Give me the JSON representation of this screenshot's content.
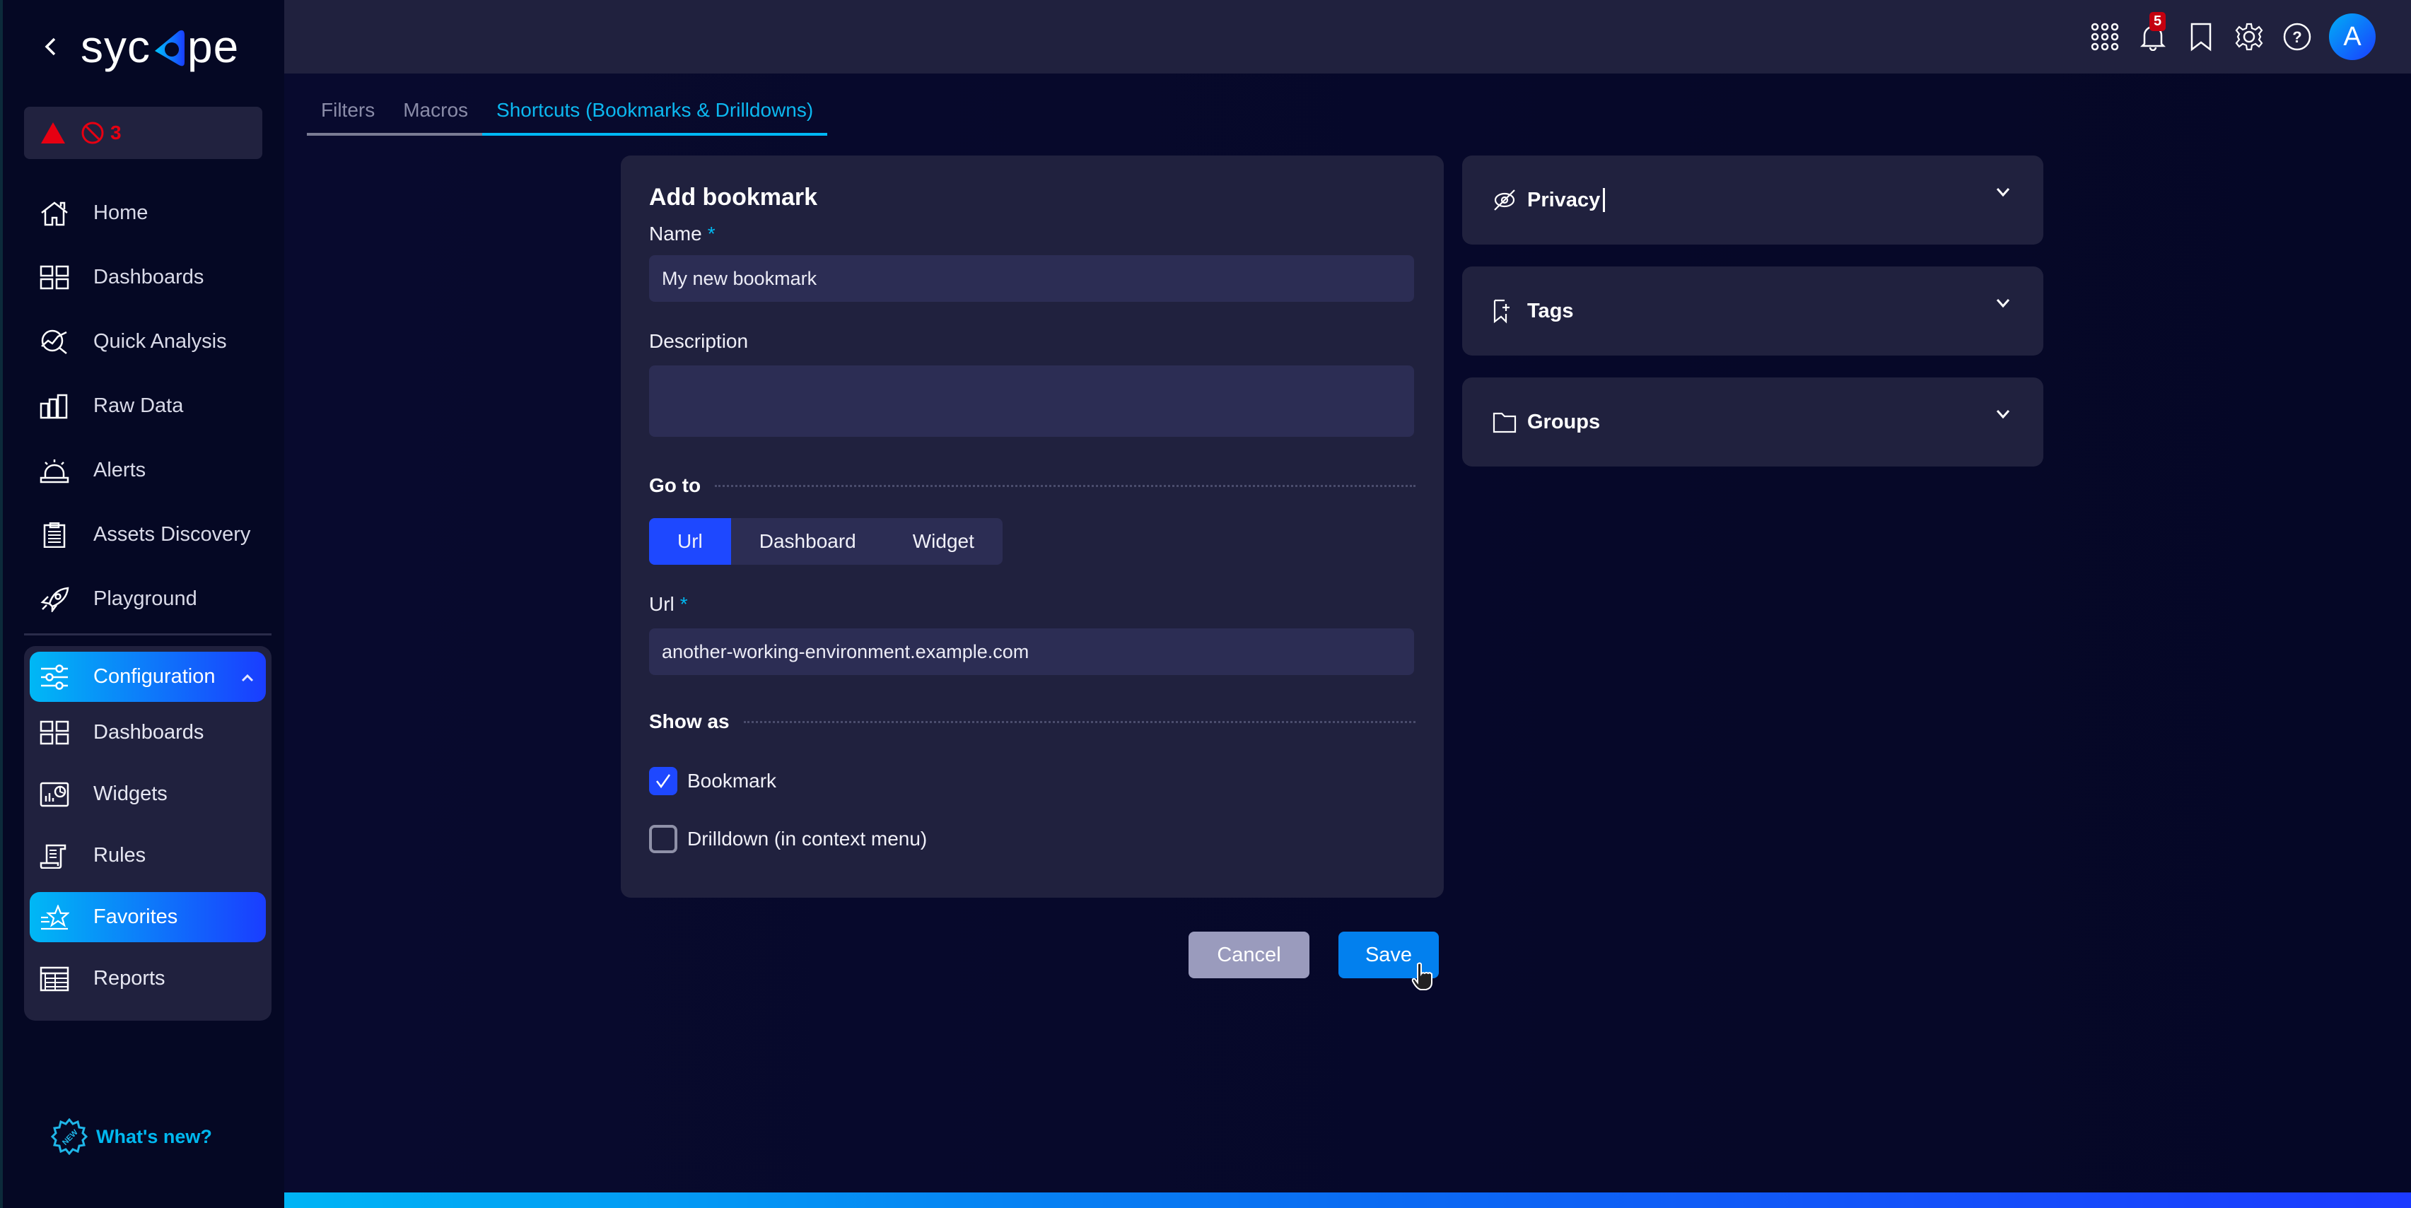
{
  "brand": {
    "name": "sycope",
    "back_label": "‹"
  },
  "alerts": {
    "warning_icon": "warning-triangle-icon",
    "blocked_icon": "blocked-icon",
    "count": "3"
  },
  "sidebar": {
    "items": [
      {
        "label": "Home",
        "icon": "home-icon"
      },
      {
        "label": "Dashboards",
        "icon": "dashboards-icon"
      },
      {
        "label": "Quick Analysis",
        "icon": "quick-analysis-icon"
      },
      {
        "label": "Raw Data",
        "icon": "raw-data-icon"
      },
      {
        "label": "Alerts",
        "icon": "alarm-icon"
      },
      {
        "label": "Assets Discovery",
        "icon": "clipboard-icon"
      },
      {
        "label": "Playground",
        "icon": "rocket-icon"
      }
    ],
    "configuration": {
      "label": "Configuration",
      "expanded": true,
      "items": [
        {
          "label": "Dashboards",
          "icon": "dashboards-icon",
          "active": false
        },
        {
          "label": "Widgets",
          "icon": "widgets-icon",
          "active": false
        },
        {
          "label": "Rules",
          "icon": "rules-icon",
          "active": false
        },
        {
          "label": "Favorites",
          "icon": "favorites-icon",
          "active": true
        },
        {
          "label": "Reports",
          "icon": "reports-icon",
          "active": false
        }
      ]
    },
    "whats_new": "What's new?"
  },
  "topbar": {
    "notifications_count": "5",
    "avatar_initial": "A"
  },
  "tabs": [
    {
      "label": "Filters",
      "active": false
    },
    {
      "label": "Macros",
      "active": false
    },
    {
      "label": "Shortcuts (Bookmarks & Drilldowns)",
      "active": true
    }
  ],
  "form": {
    "title": "Add bookmark",
    "name_label": "Name",
    "required_mark": "*",
    "name_value": "My new bookmark",
    "description_label": "Description",
    "description_value": "",
    "goto_label": "Go to",
    "goto_options": [
      "Url",
      "Dashboard",
      "Widget"
    ],
    "goto_selected": "Url",
    "url_label": "Url",
    "url_value": "another-working-environment.example.com",
    "show_as_label": "Show as",
    "show_as": [
      {
        "label": "Bookmark",
        "checked": true
      },
      {
        "label": "Drilldown (in context menu)",
        "checked": false
      }
    ],
    "cancel_label": "Cancel",
    "save_label": "Save"
  },
  "panels": [
    {
      "label": "Privacy",
      "icon": "eye-off-icon"
    },
    {
      "label": "Tags",
      "icon": "bookmark-plus-icon"
    },
    {
      "label": "Groups",
      "icon": "folder-icon"
    }
  ],
  "colors": {
    "accent": "#00b8f5",
    "primary": "#1e48ff",
    "save": "#0280ee",
    "danger": "#e60012"
  }
}
